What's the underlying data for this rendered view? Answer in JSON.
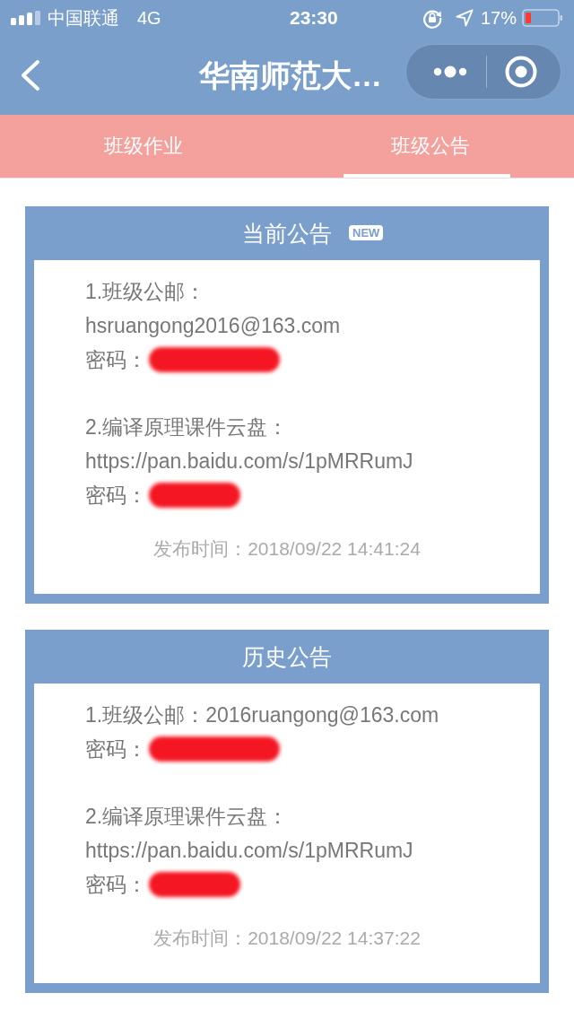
{
  "status_bar": {
    "carrier": "中国联通",
    "network": "4G",
    "time": "23:30",
    "battery": "17%"
  },
  "nav_bar": {
    "title": "华南师范大…"
  },
  "tabs": [
    {
      "label": "班级作业",
      "selected": false
    },
    {
      "label": "班级公告",
      "selected": true
    }
  ],
  "notices": [
    {
      "title": "当前公告",
      "badge": "NEW",
      "items": [
        {
          "lines": [
            "1.班级公邮：",
            "hsruangong2016@163.com"
          ],
          "password_label": "密码：",
          "password_redacted": true
        },
        {
          "lines": [
            "2.编译原理课件云盘：",
            "https://pan.baidu.com/s/1pMRRumJ"
          ],
          "password_label": "密码：",
          "password_redacted": true
        }
      ],
      "time": "发布时间：2018/09/22 14:41:24"
    },
    {
      "title": "历史公告",
      "items": [
        {
          "lines": [
            "1.班级公邮：2016ruangong@163.com"
          ],
          "password_label": "密码：",
          "password_redacted": true
        },
        {
          "lines": [
            "2.编译原理课件云盘：",
            "https://pan.baidu.com/s/1pMRRumJ"
          ],
          "password_label": "密码：",
          "password_redacted": true
        }
      ],
      "time": "发布时间：2018/09/22 14:37:22"
    }
  ]
}
